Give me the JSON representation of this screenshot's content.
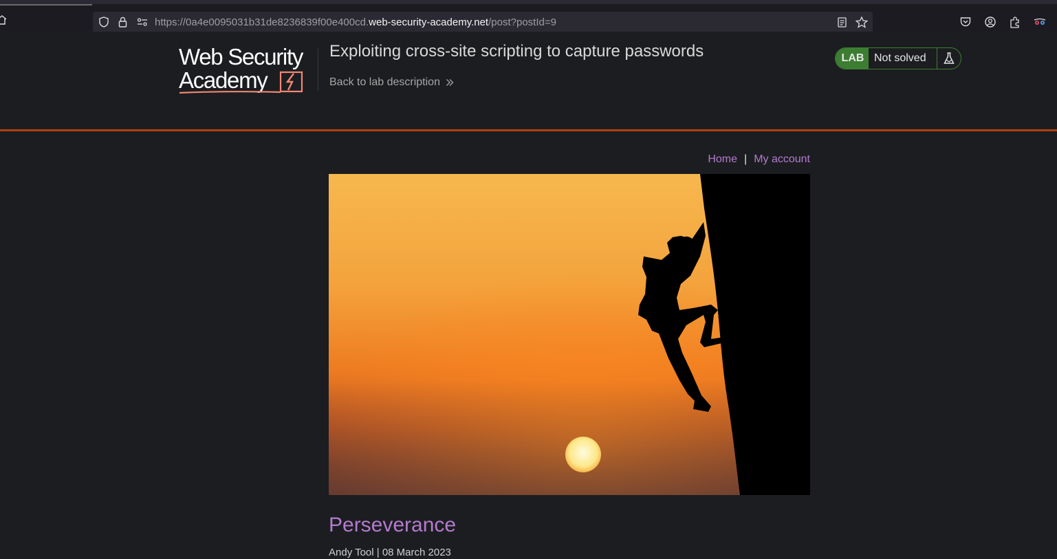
{
  "browser": {
    "url_prefix": "https://0a4e0095031b31de8236839f00e400cd.",
    "url_domain": "web-security-academy.net",
    "url_path": "/post?postId=9",
    "icons": [
      "home-icon",
      "shield-icon",
      "lock-icon",
      "permissions-icon",
      "reader-view-icon",
      "bookmark-star-icon",
      "pocket-icon",
      "account-icon",
      "extensions-icon",
      "extension-glasses-icon"
    ]
  },
  "header": {
    "logo_line1": "Web Security",
    "logo_line2": "Academy",
    "lab_title": "Exploiting cross-site scripting to capture passwords",
    "back_link": "Back to lab description",
    "lab_badge": "LAB",
    "lab_status": "Not solved",
    "accent_color": "#b3400e",
    "status_color": "#3c7d32"
  },
  "nav": {
    "home": "Home",
    "separator": "|",
    "my_account": "My account"
  },
  "post": {
    "title": "Perseverance",
    "meta": "Andy Tool | 08 March 2023",
    "image_description_icon": "climber-sunset-image"
  }
}
